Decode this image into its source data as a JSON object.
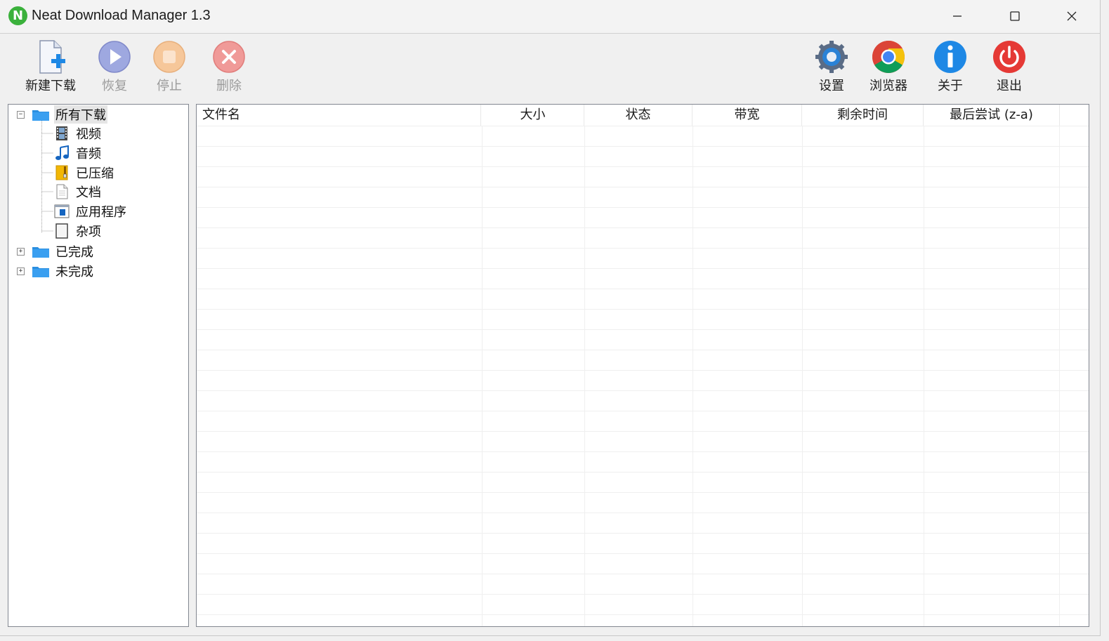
{
  "window": {
    "title": "Neat Download Manager 1.3",
    "logo_letter": "N"
  },
  "toolbar": {
    "new_download": "新建下载",
    "resume": "恢复",
    "stop": "停止",
    "delete": "删除",
    "settings": "设置",
    "browser": "浏览器",
    "about": "关于",
    "exit": "退出"
  },
  "tree": {
    "all_downloads": "所有下载",
    "children": [
      "视频",
      "音频",
      "已压缩",
      "文档",
      "应用程序",
      "杂项"
    ],
    "completed": "已完成",
    "incomplete": "未完成"
  },
  "list": {
    "columns": [
      "文件名",
      "大小",
      "状态",
      "带宽",
      "剩余时间",
      "最后尝试 (z-a)"
    ]
  },
  "colors": {
    "accent_blue": "#1e88e5",
    "folder_blue": "#2b8fe0",
    "delete_red": "#e53935",
    "resume_blue": "#5c6bc0"
  }
}
